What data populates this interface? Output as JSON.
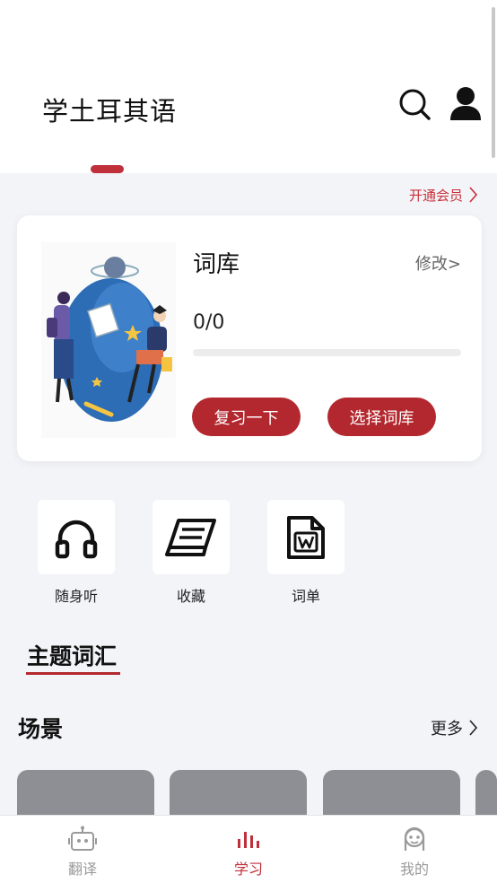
{
  "header": {
    "title": "学土耳其语",
    "search_icon": "search-icon",
    "user_icon": "user-icon"
  },
  "vip": {
    "label": "开通会员"
  },
  "wordbank_card": {
    "title": "词库",
    "edit_label": "修改>",
    "progress_text": "0/0",
    "progress_fraction": 0,
    "review_label": "复习一下",
    "choose_label": "选择词库"
  },
  "features": [
    {
      "label": "随身听",
      "icon": "headphones-icon"
    },
    {
      "label": "收藏",
      "icon": "book-icon"
    },
    {
      "label": "词单",
      "icon": "word-document-icon"
    }
  ],
  "topic_section": {
    "title": "主题词汇"
  },
  "scene_section": {
    "title": "场景",
    "more_label": "更多"
  },
  "bottom_nav": [
    {
      "label": "翻译",
      "icon": "robot-icon",
      "active": false
    },
    {
      "label": "学习",
      "icon": "bars-icon",
      "active": true
    },
    {
      "label": "我的",
      "icon": "face-icon",
      "active": false
    }
  ],
  "colors": {
    "accent": "#c0303a",
    "button": "#b3282f",
    "background": "#f3f4f8",
    "scene_placeholder": "#8d8f95"
  }
}
